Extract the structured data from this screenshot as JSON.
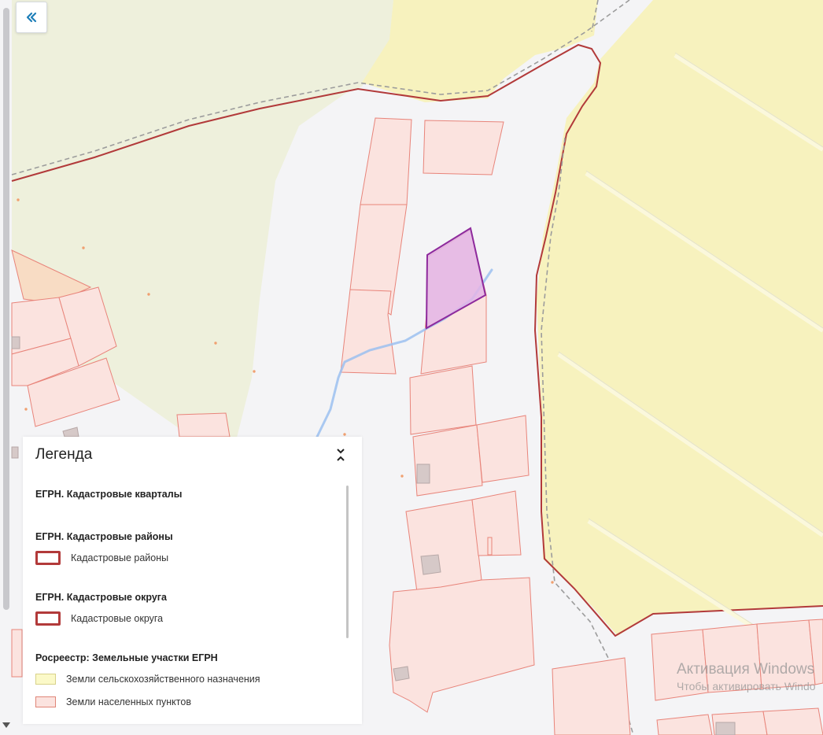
{
  "map": {
    "colors": {
      "background": "#f4f4f6",
      "agricultural_land": "#f7f2be",
      "forest_green": "#eef0dc",
      "settlement_parcel": "#fbe3df",
      "parcel_border": "#e8847a",
      "district_border": "#b23a3a",
      "selected_parcel_fill": "#e3b5e6",
      "selected_parcel_border": "#8e2a9c",
      "stream": "#9bbff0"
    }
  },
  "controls": {
    "collapse_icon": "chevrons-left-icon"
  },
  "legend": {
    "title": "Легенда",
    "toggle_icon": "chevron-up-down-icon",
    "groups": [
      {
        "title": "ЕГРН. Кадастровые кварталы",
        "items": []
      },
      {
        "title": "ЕГРН. Кадастровые районы",
        "items": [
          {
            "label": "Кадастровые районы",
            "swatch": "outline",
            "color": "#b23a3a"
          }
        ]
      },
      {
        "title": "ЕГРН. Кадастровые округа",
        "items": [
          {
            "label": "Кадастровые округа",
            "swatch": "outline",
            "color": "#b23a3a"
          }
        ]
      },
      {
        "title": "Росреестр: Земельные участки ЕГРН",
        "items": [
          {
            "label": "Земли сельскохозяйственного назначения",
            "swatch": "fill",
            "color": "#fbf9c8",
            "border": "#d8d28a"
          },
          {
            "label": "Земли населенных пунктов",
            "swatch": "fill",
            "color": "#fbe3df",
            "border": "#e08577"
          }
        ]
      }
    ]
  },
  "watermark": {
    "line1": "Активация Windows",
    "line2": "Чтобы активировать Windo"
  }
}
